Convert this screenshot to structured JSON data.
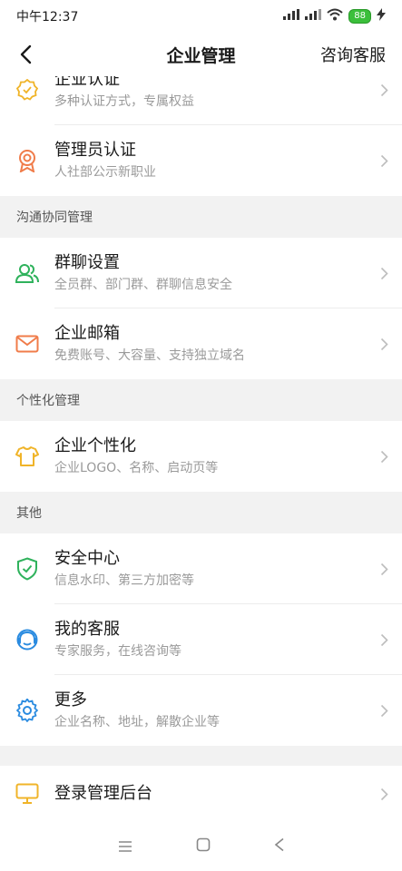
{
  "status_bar": {
    "time": "中午12:37",
    "battery": "88"
  },
  "nav": {
    "title": "企业管理",
    "action": "咨询客服"
  },
  "top_items": [
    {
      "title": "企业认证",
      "subtitle": "多种认证方式，专属权益",
      "icon": "verified-badge-icon"
    },
    {
      "title": "管理员认证",
      "subtitle": "人社部公示新职业",
      "icon": "award-medal-icon"
    }
  ],
  "sections": [
    {
      "header": "沟通协同管理",
      "items": [
        {
          "title": "群聊设置",
          "subtitle": "全员群、部门群、群聊信息安全",
          "icon": "group-users-icon"
        },
        {
          "title": "企业邮箱",
          "subtitle": "免费账号、大容量、支持独立域名",
          "icon": "mail-icon"
        }
      ]
    },
    {
      "header": "个性化管理",
      "items": [
        {
          "title": "企业个性化",
          "subtitle": "企业LOGO、名称、启动页等",
          "icon": "tshirt-icon"
        }
      ]
    },
    {
      "header": "其他",
      "items": [
        {
          "title": "安全中心",
          "subtitle": "信息水印、第三方加密等",
          "icon": "shield-check-icon"
        },
        {
          "title": "我的客服",
          "subtitle": "专家服务，在线咨询等",
          "icon": "customer-service-icon"
        },
        {
          "title": "更多",
          "subtitle": "企业名称、地址，解散企业等",
          "icon": "gear-icon"
        }
      ]
    }
  ],
  "admin_item": {
    "title": "登录管理后台",
    "icon": "monitor-icon"
  },
  "colors": {
    "yellow": "#f0b429",
    "orange": "#f07c4a",
    "green": "#2fb25c",
    "blue": "#2a8be0"
  }
}
